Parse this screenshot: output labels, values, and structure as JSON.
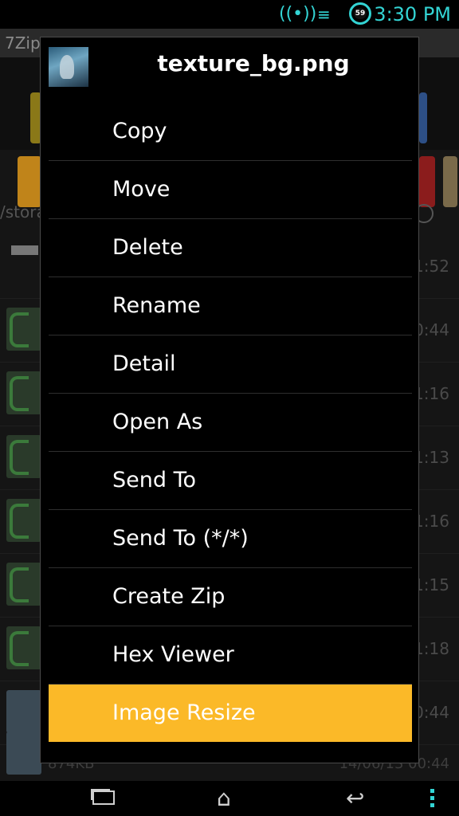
{
  "status": {
    "time": "3:30 PM",
    "battery_level": "59",
    "icons": [
      "wireless-signal-icon",
      "signal-bars-icon",
      "battery-icon"
    ]
  },
  "background_app": {
    "title": "7Zip",
    "path": "/stora",
    "rows": [
      {
        "time": "1:52"
      },
      {
        "time": "0:44"
      },
      {
        "time": "1:16"
      },
      {
        "time": "1:13"
      },
      {
        "time": "1:16"
      },
      {
        "time": "1:15"
      },
      {
        "time": "1:18"
      },
      {
        "time": "0:44"
      },
      {
        "size": "874KB",
        "date": "14/06/13 00:44"
      }
    ]
  },
  "dialog": {
    "title": "texture_bg.png",
    "items": [
      {
        "label": "Copy"
      },
      {
        "label": "Move"
      },
      {
        "label": "Delete"
      },
      {
        "label": "Rename"
      },
      {
        "label": "Detail"
      },
      {
        "label": "Open As"
      },
      {
        "label": "Send To"
      },
      {
        "label": "Send To (*/*)"
      },
      {
        "label": "Create Zip"
      },
      {
        "label": "Hex Viewer"
      },
      {
        "label": "Image Resize"
      }
    ],
    "selected_index": 10,
    "accent_color": "#fbb928"
  },
  "navbar": {
    "icons": [
      "recent-apps-icon",
      "home-icon",
      "back-icon",
      "menu-dots-icon"
    ]
  }
}
